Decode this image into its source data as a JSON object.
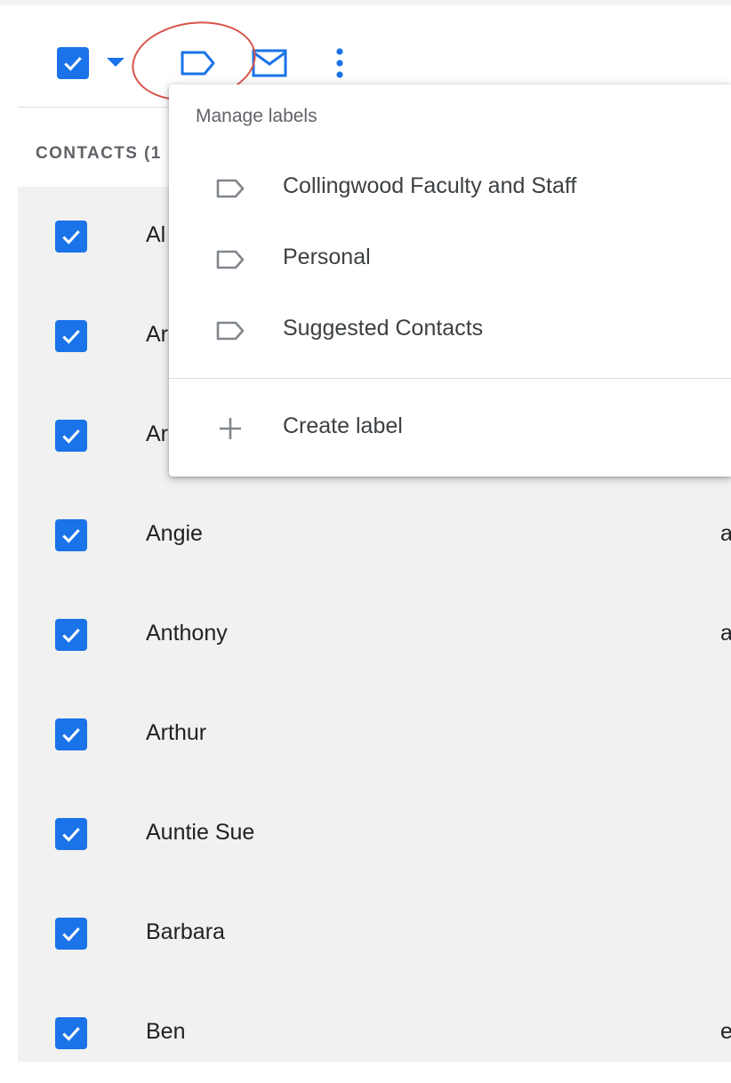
{
  "toolbar": {
    "select_all_checked": true,
    "icons": [
      "checkbox-checked-icon",
      "caret-down-icon",
      "label-icon",
      "mail-icon",
      "more-vert-icon"
    ]
  },
  "section": {
    "header": "CONTACTS (1"
  },
  "contacts": [
    {
      "name": "Al",
      "extra": ""
    },
    {
      "name": "Ar",
      "extra": ""
    },
    {
      "name": "Ar",
      "extra": ""
    },
    {
      "name": "Angie",
      "extra": "a"
    },
    {
      "name": "Anthony",
      "extra": "a"
    },
    {
      "name": "Arthur",
      "extra": ""
    },
    {
      "name": "Auntie Sue",
      "extra": ""
    },
    {
      "name": "Barbara",
      "extra": ""
    },
    {
      "name": "Ben",
      "extra": "e"
    }
  ],
  "label_menu": {
    "title": "Manage labels",
    "labels": [
      "Collingwood Faculty and Staff",
      "Personal",
      "Suggested Contacts"
    ],
    "create_label": "Create label"
  },
  "colors": {
    "accent": "#1a73e8",
    "list_background": "#f1f1f1",
    "highlight_ring": "#d9534a"
  }
}
